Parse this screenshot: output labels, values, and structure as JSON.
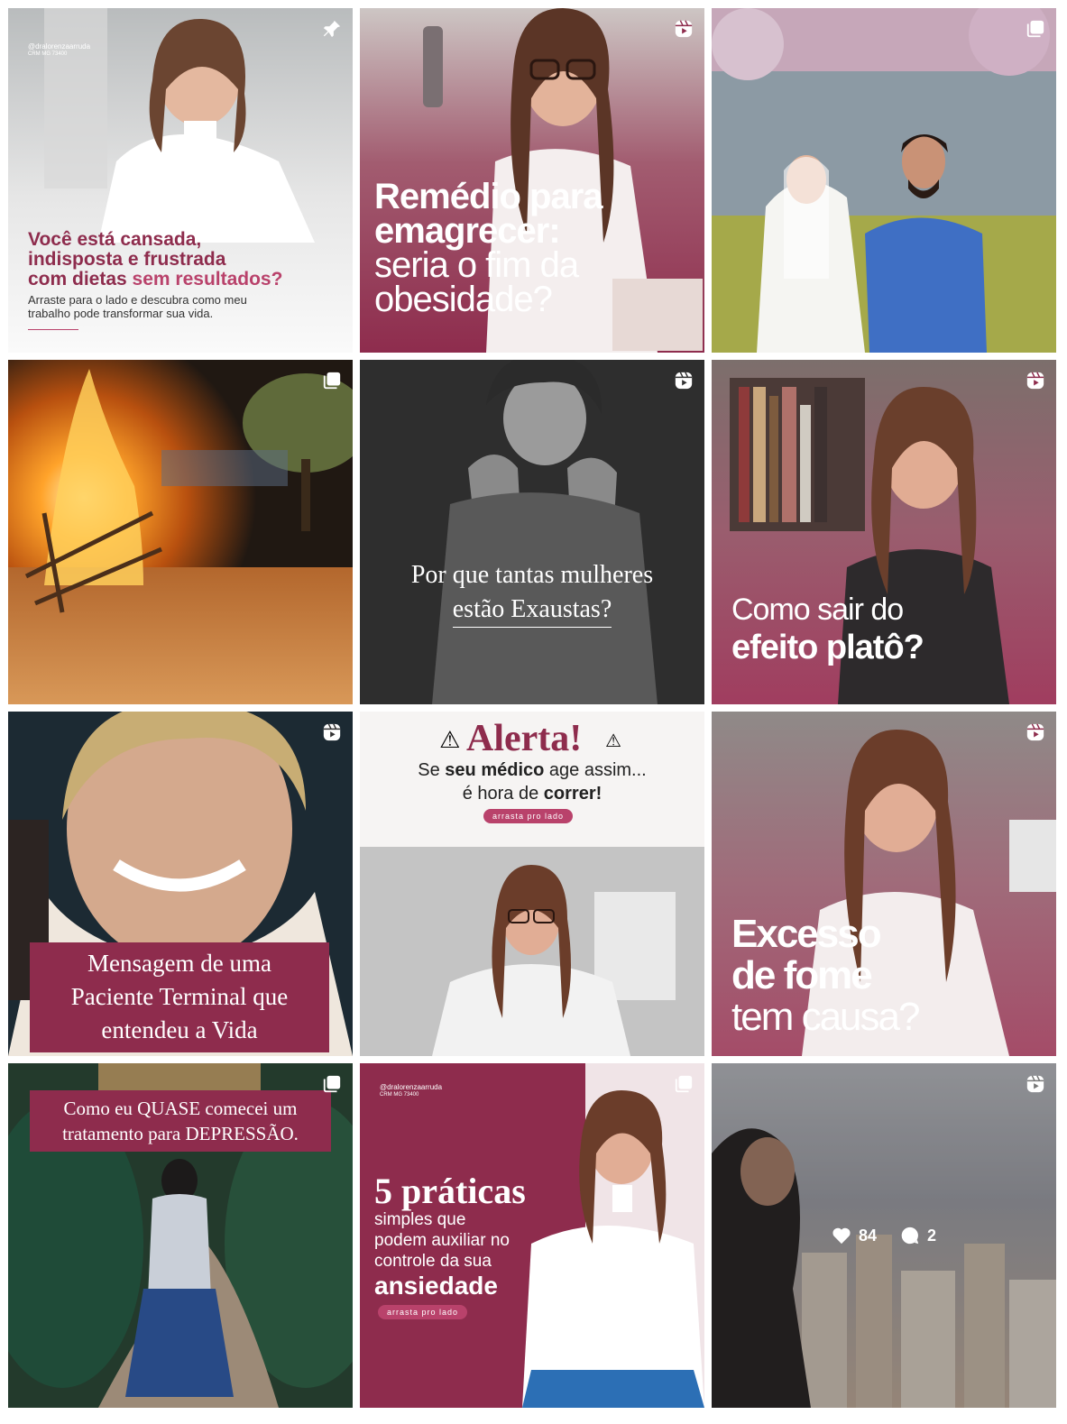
{
  "grid": {
    "posts": [
      {
        "type": "pinned",
        "handle_line1": "@dralorenzaarruda",
        "handle_line2": "CRM MG 73400",
        "headline_line1": "Você está cansada,",
        "headline_line2": "indisposta e frustrada",
        "headline_line3a": "com dietas ",
        "headline_line3b": "sem resultados?",
        "subtext_line1": "Arraste para o lado e descubra como meu",
        "subtext_line2": "trabalho pode transformar sua vida."
      },
      {
        "type": "reel",
        "headline_line1": "Remédio para",
        "headline_line2": "emagrecer:",
        "headline_line3": "seria o fim da",
        "headline_line4": "obesidade?"
      },
      {
        "type": "carousel"
      },
      {
        "type": "carousel"
      },
      {
        "type": "reel",
        "headline_line1": "Por que tantas mulheres",
        "headline_line2": "estão Exaustas?"
      },
      {
        "type": "reel",
        "headline_line1": "Como sair do",
        "headline_line2": "efeito platô?"
      },
      {
        "type": "reel",
        "headline_line1": "Mensagem de uma",
        "headline_line2": "Paciente Terminal que",
        "headline_line3": "entendeu a Vida"
      },
      {
        "type": "carousel",
        "title": "Alerta!",
        "line1a": "Se ",
        "line1b": "seu médico",
        "line1c": " age assim...",
        "line2a": "é hora de ",
        "line2b": "correr!",
        "pill": "arrasta pro lado"
      },
      {
        "type": "reel",
        "headline_line1": "Excesso",
        "headline_line2": "de fome",
        "headline_line3": "tem causa?"
      },
      {
        "type": "carousel",
        "headline_line1": "Como eu QUASE comecei um",
        "headline_line2": "tratamento para DEPRESSÃO."
      },
      {
        "type": "carousel",
        "handle_line1": "@dralorenzaarruda",
        "handle_line2": "CRM MG 73400",
        "title": "5 práticas",
        "line1": "simples que",
        "line2": "podem auxiliar no",
        "line3": "controle da sua",
        "line4": "ansiedade",
        "pill": "arrasta pro lado"
      },
      {
        "type": "reel",
        "likes": "84",
        "comments": "2"
      }
    ]
  },
  "colors": {
    "brand_wine": "#8e2c4d",
    "brand_pink": "#b9426b",
    "badge_white": "#ffffff"
  },
  "icons": {
    "pinned": "pin-icon",
    "reel": "reel-icon",
    "carousel": "carousel-icon",
    "likes": "heart-icon",
    "comments": "comment-icon"
  }
}
